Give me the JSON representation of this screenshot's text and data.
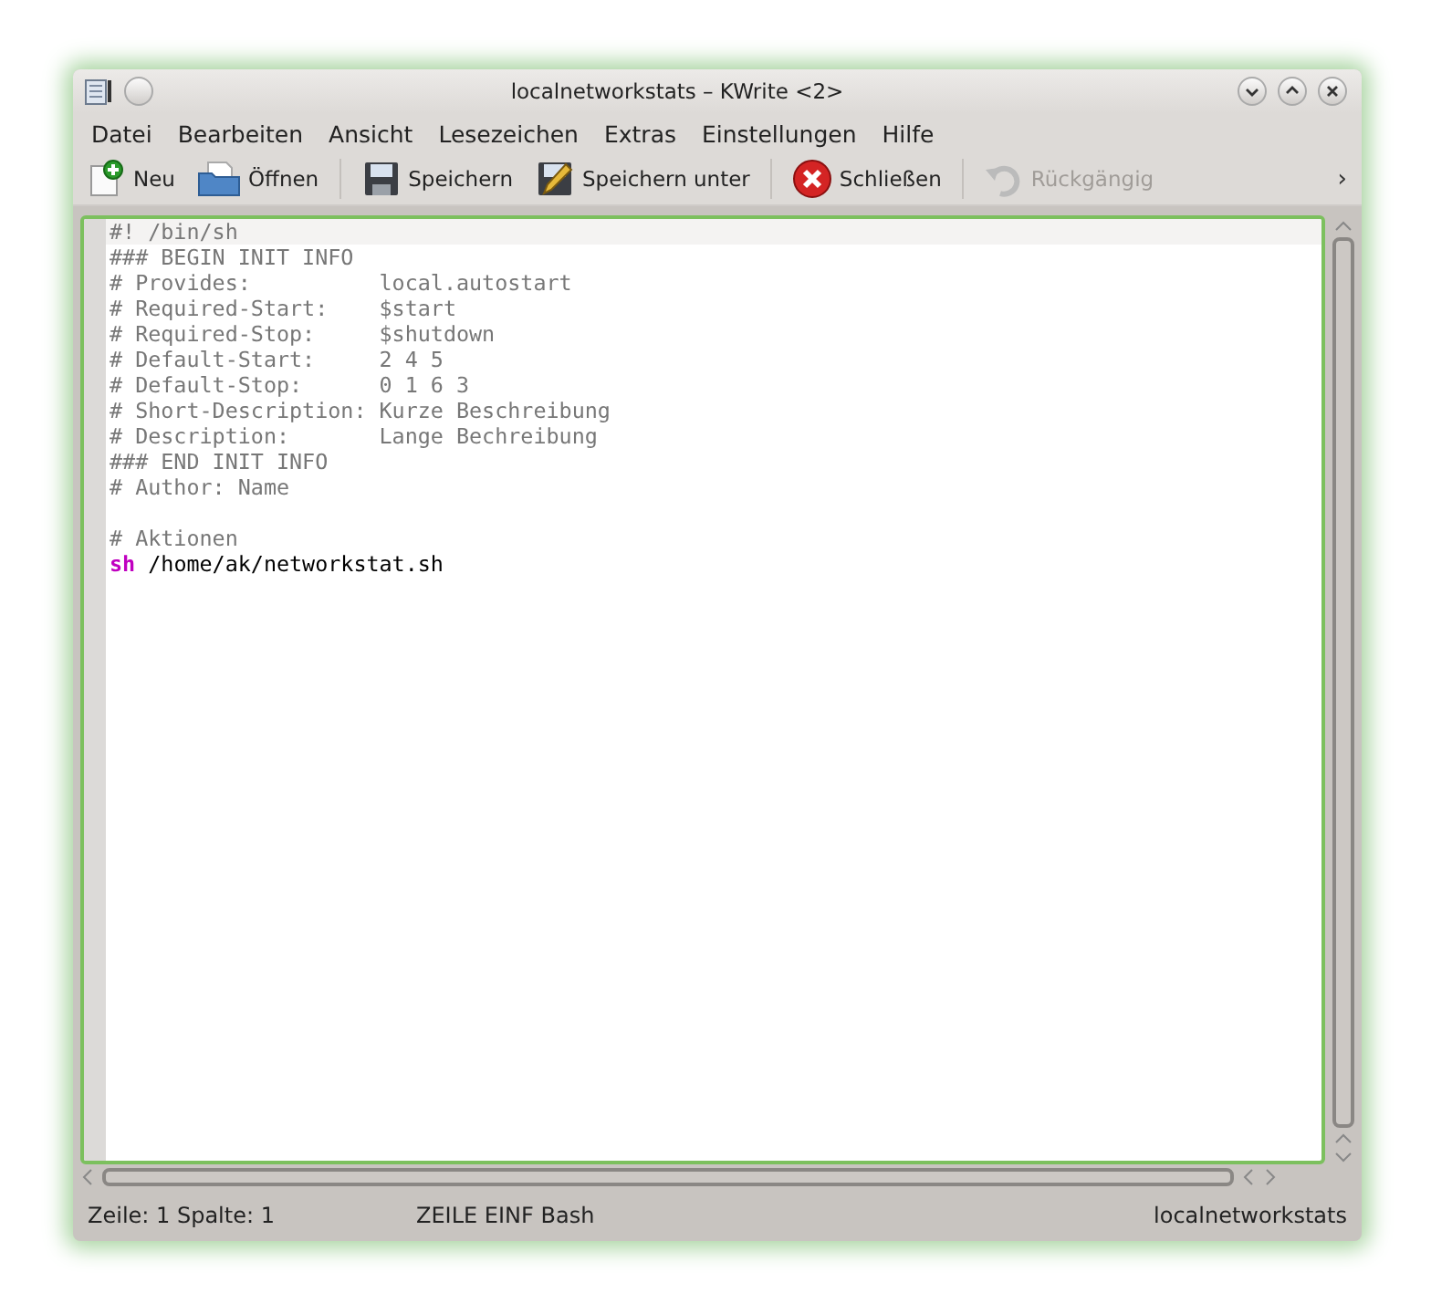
{
  "window": {
    "title": "localnetworkstats – KWrite <2>"
  },
  "menu": [
    {
      "label": "Datei"
    },
    {
      "label": "Bearbeiten"
    },
    {
      "label": "Ansicht"
    },
    {
      "label": "Lesezeichen"
    },
    {
      "label": "Extras"
    },
    {
      "label": "Einstellungen"
    },
    {
      "label": "Hilfe"
    }
  ],
  "toolbar": [
    {
      "kind": "new",
      "label": "Neu",
      "disabled": false
    },
    {
      "kind": "open",
      "label": "Öffnen",
      "disabled": false
    },
    {
      "kind": "separator"
    },
    {
      "kind": "save",
      "label": "Speichern",
      "disabled": false
    },
    {
      "kind": "saveas",
      "label": "Speichern unter",
      "disabled": false
    },
    {
      "kind": "separator"
    },
    {
      "kind": "close",
      "label": "Schließen",
      "disabled": false
    },
    {
      "kind": "separator"
    },
    {
      "kind": "undo",
      "label": "Rückgängig",
      "disabled": true
    }
  ],
  "toolbar_more": "›",
  "editor": {
    "lines": [
      {
        "current": true,
        "segments": [
          {
            "kind": "comment",
            "text": "#! /bin/sh"
          }
        ]
      },
      {
        "current": false,
        "segments": [
          {
            "kind": "comment",
            "text": "### BEGIN INIT INFO"
          }
        ]
      },
      {
        "current": false,
        "segments": [
          {
            "kind": "comment",
            "text": "# Provides:          local.autostart"
          }
        ]
      },
      {
        "current": false,
        "segments": [
          {
            "kind": "comment",
            "text": "# Required-Start:    $start"
          }
        ]
      },
      {
        "current": false,
        "segments": [
          {
            "kind": "comment",
            "text": "# Required-Stop:     $shutdown"
          }
        ]
      },
      {
        "current": false,
        "segments": [
          {
            "kind": "comment",
            "text": "# Default-Start:     2 4 5"
          }
        ]
      },
      {
        "current": false,
        "segments": [
          {
            "kind": "comment",
            "text": "# Default-Stop:      0 1 6 3"
          }
        ]
      },
      {
        "current": false,
        "segments": [
          {
            "kind": "comment",
            "text": "# Short-Description: Kurze Beschreibung"
          }
        ]
      },
      {
        "current": false,
        "segments": [
          {
            "kind": "comment",
            "text": "# Description:       Lange Bechreibung"
          }
        ]
      },
      {
        "current": false,
        "segments": [
          {
            "kind": "comment",
            "text": "### END INIT INFO"
          }
        ]
      },
      {
        "current": false,
        "segments": [
          {
            "kind": "comment",
            "text": "# Author: Name"
          }
        ]
      },
      {
        "current": false
      },
      {
        "current": false,
        "segments": [
          {
            "kind": "comment",
            "text": "# Aktionen"
          }
        ]
      },
      {
        "current": false,
        "segments": [
          {
            "kind": "keyword",
            "text": "sh"
          },
          {
            "kind": "plain",
            "text": " /home/ak/networkstat.sh"
          }
        ]
      }
    ]
  },
  "status_bar": {
    "position": "Zeile: 1 Spalte: 1",
    "mode": "ZEILE EINF Bash",
    "filename": "localnetworkstats"
  }
}
